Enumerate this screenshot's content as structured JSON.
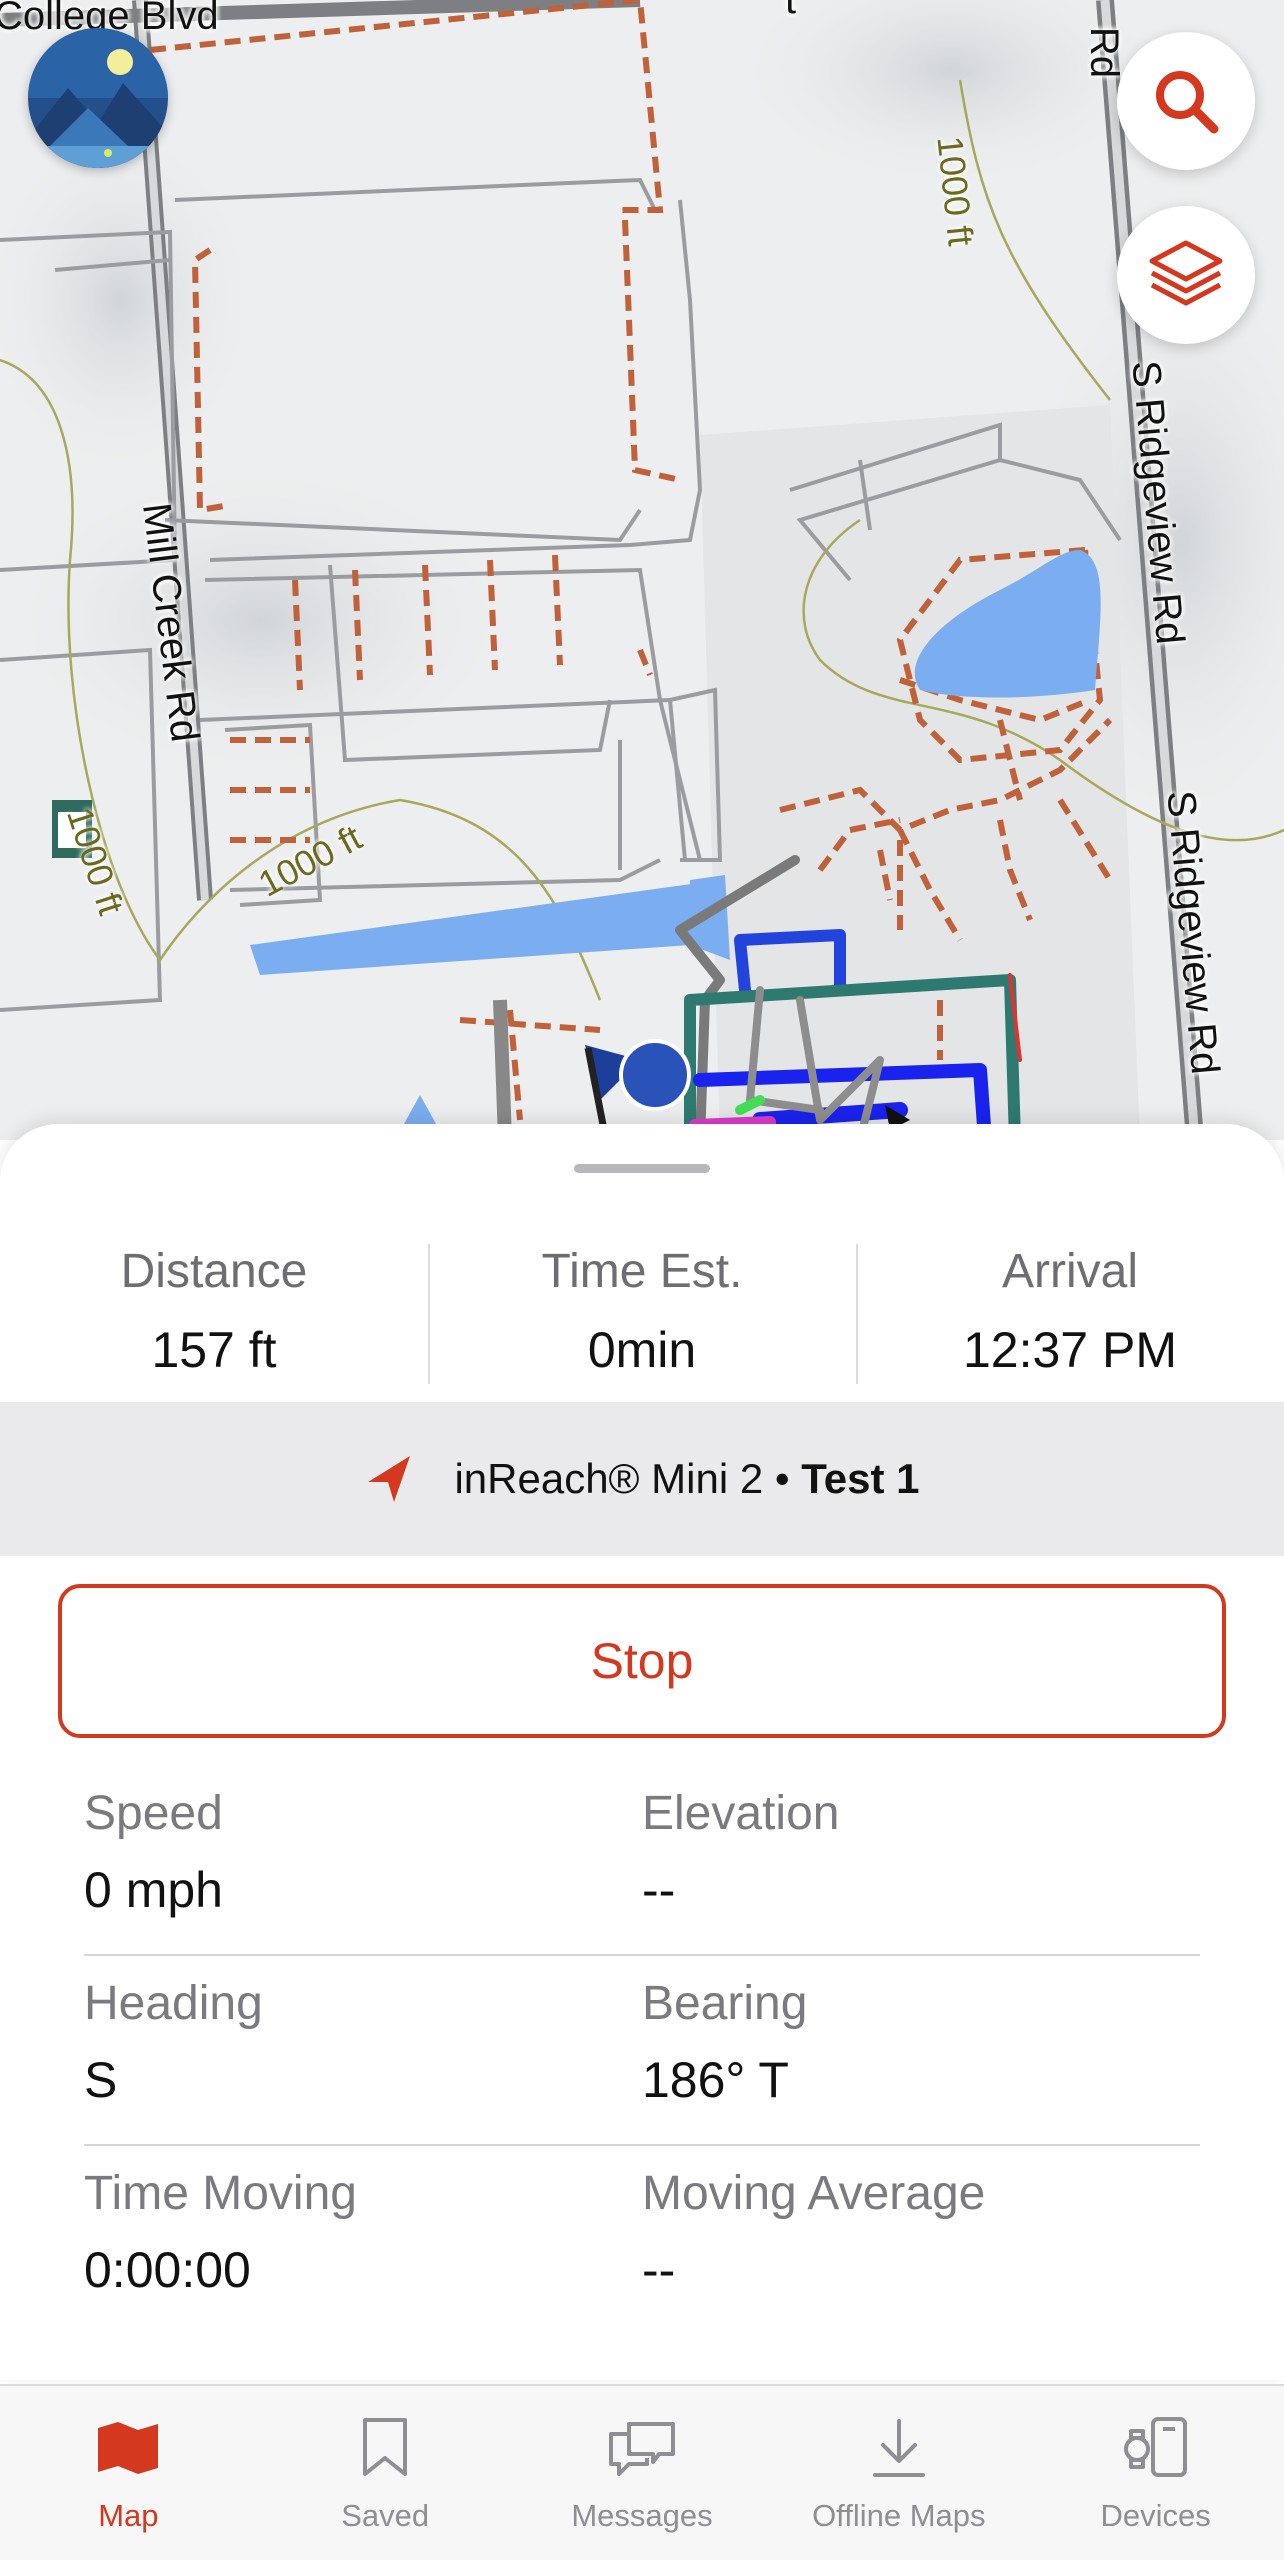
{
  "map": {
    "road_labels": {
      "college_blvd": "College Blvd",
      "mill_creek_rd": "Mill Creek Rd",
      "s_ridgeview_rd_1": "S Ridgeview Rd",
      "s_ridgeview_rd_2": "S Ridgeview Rd",
      "top_right_fragment": "Rd",
      "top_fragment": "t"
    },
    "contour_labels": [
      "1000 ft",
      "1000 ft",
      "1000 ft"
    ],
    "icons": {
      "search": "search-icon",
      "layers": "layers-icon",
      "avatar": "profile-avatar"
    }
  },
  "route": {
    "distance_label": "Distance",
    "distance_value": "157 ft",
    "time_label": "Time Est.",
    "time_value": "0min",
    "arrival_label": "Arrival",
    "arrival_value": "12:37 PM"
  },
  "device": {
    "name": "inReach® Mini 2",
    "separator": " • ",
    "activity": "Test 1"
  },
  "actions": {
    "stop_label": "Stop"
  },
  "metrics": [
    [
      {
        "label": "Speed",
        "value": "0 mph"
      },
      {
        "label": "Elevation",
        "value": "--"
      }
    ],
    [
      {
        "label": "Heading",
        "value": "S"
      },
      {
        "label": "Bearing",
        "value": "186° T"
      }
    ],
    [
      {
        "label": "Time Moving",
        "value": "0:00:00"
      },
      {
        "label": "Moving Average",
        "value": "--"
      }
    ]
  ],
  "tabs": [
    {
      "label": "Map",
      "icon": "map-icon",
      "active": true
    },
    {
      "label": "Saved",
      "icon": "bookmark-icon",
      "active": false
    },
    {
      "label": "Messages",
      "icon": "messages-icon",
      "active": false
    },
    {
      "label": "Offline Maps",
      "icon": "download-icon",
      "active": false
    },
    {
      "label": "Devices",
      "icon": "devices-icon",
      "active": false
    }
  ],
  "colors": {
    "accent": "#d4391f",
    "water": "#7aaef0",
    "trail": "#c0613a",
    "sheet_band": "#eaeaec"
  }
}
